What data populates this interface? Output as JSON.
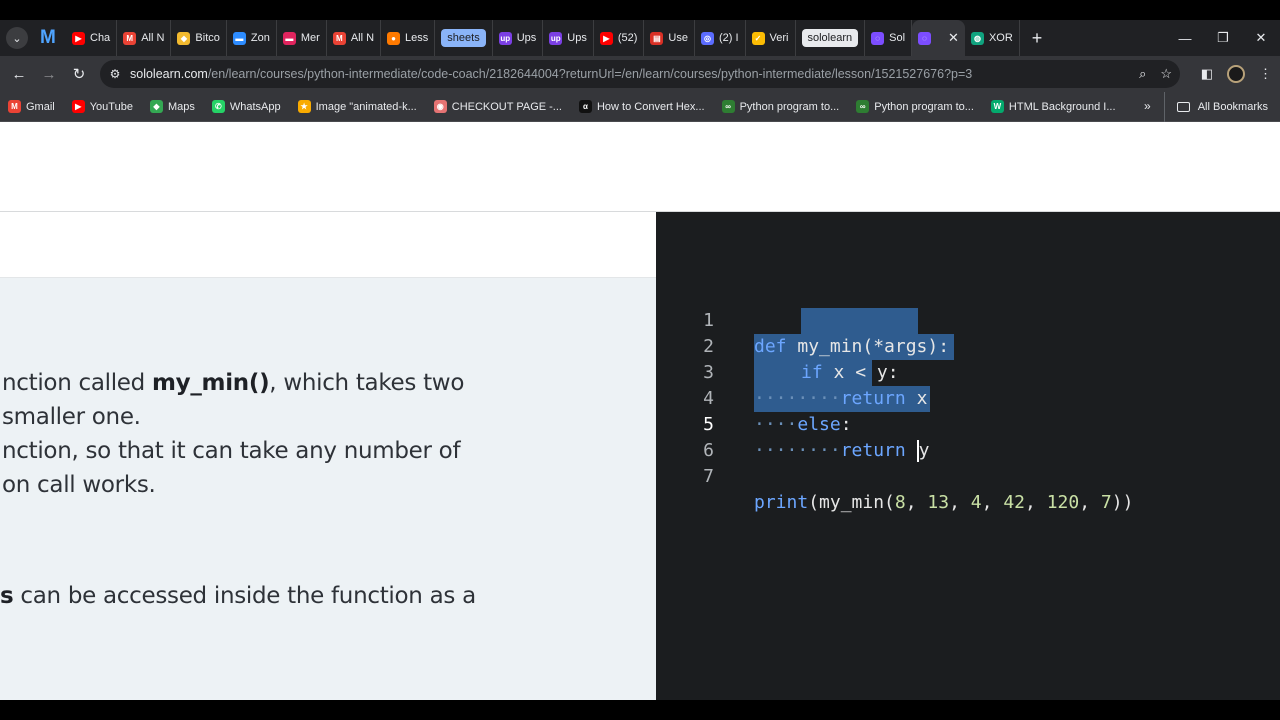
{
  "browser": {
    "tabs": [
      {
        "label": "Cha",
        "color": "#ff0000",
        "glyph": "▶"
      },
      {
        "label": "All N",
        "color": "#ea4335",
        "glyph": "M"
      },
      {
        "label": "Bitco",
        "color": "#f3ba2f",
        "glyph": "◆"
      },
      {
        "label": "Zon",
        "color": "#2d8cff",
        "glyph": "▬"
      },
      {
        "label": "Mer",
        "color": "#e0245e",
        "glyph": "▬"
      },
      {
        "label": "All N",
        "color": "#ea4335",
        "glyph": "M"
      },
      {
        "label": "Less",
        "color": "#ff7a00",
        "glyph": "●"
      },
      {
        "label": "sheets",
        "pill": "blue"
      },
      {
        "label": "Ups",
        "color": "#7b3fe4",
        "glyph": "up"
      },
      {
        "label": "Ups",
        "color": "#7b3fe4",
        "glyph": "up"
      },
      {
        "label": "(52)",
        "color": "#ff0000",
        "glyph": "▶"
      },
      {
        "label": "Use",
        "color": "#d93025",
        "glyph": "▤"
      },
      {
        "label": "(2) I",
        "color": "#5b6cff",
        "glyph": "◎"
      },
      {
        "label": "Veri",
        "color": "#fbbc04",
        "glyph": "✓"
      },
      {
        "label": "sololearn",
        "pill": "light"
      },
      {
        "label": "Sol",
        "color": "#7c4dff",
        "glyph": "◌"
      },
      {
        "label": "",
        "color": "#7c4dff",
        "glyph": "◌",
        "active": true
      },
      {
        "label": "XOR",
        "color": "#10a37f",
        "glyph": "◍"
      }
    ],
    "url_host": "sololearn.com",
    "url_path": "/en/learn/courses/python-intermediate/code-coach/2182644004?returnUrl=/en/learn/courses/python-intermediate/lesson/1521527676?p=3",
    "bookmarks": [
      {
        "label": "Gmail",
        "color": "#ea4335",
        "glyph": "M"
      },
      {
        "label": "YouTube",
        "color": "#ff0000",
        "glyph": "▶"
      },
      {
        "label": "Maps",
        "color": "#34a853",
        "glyph": "◆"
      },
      {
        "label": "WhatsApp",
        "color": "#25d366",
        "glyph": "✆"
      },
      {
        "label": "Image \"animated-k...",
        "color": "#f9ab00",
        "glyph": "★"
      },
      {
        "label": "CHECKOUT PAGE -...",
        "color": "#e57373",
        "glyph": "◉"
      },
      {
        "label": "How to Convert Hex...",
        "color": "#111111",
        "glyph": "α"
      },
      {
        "label": "Python program to...",
        "color": "#2e7d32",
        "glyph": "∞"
      },
      {
        "label": "Python program to...",
        "color": "#2e7d32",
        "glyph": "∞"
      },
      {
        "label": "HTML Background I...",
        "color": "#04aa6d",
        "glyph": "W"
      }
    ],
    "all_bookmarks": "All Bookmarks"
  },
  "lesson": {
    "lines": [
      {
        "pre": "nction called ",
        "bold": "my_min()",
        "post": ", which takes two"
      },
      {
        "pre": "smaller one.",
        "bold": "",
        "post": ""
      },
      {
        "pre": "nction, so that it can take any number of",
        "bold": "",
        "post": ""
      },
      {
        "pre": "on call works.",
        "bold": "",
        "post": ""
      },
      {
        "pre": "",
        "bold": "s",
        "post": " can be accessed inside the function as a"
      }
    ]
  },
  "editor": {
    "line_numbers": [
      "1",
      "2",
      "3",
      "4",
      "5",
      "6",
      "7"
    ],
    "current_line": "5",
    "code": {
      "l1_kw": "def",
      "l1_rest": " my_min(*args):",
      "l2_kw": "if",
      "l2_rest": " x < y:",
      "l3_kw": "return",
      "l3_rest": " x",
      "l4_kw": "else",
      "l4_rest": ":",
      "l5_kw": "return",
      "l5_rest": "y",
      "l7_fn": "print",
      "l7_a": "(my_min(",
      "l7_nums": [
        "8",
        "13",
        "4",
        "42",
        "120",
        "7"
      ],
      "l7_end": "))"
    }
  }
}
